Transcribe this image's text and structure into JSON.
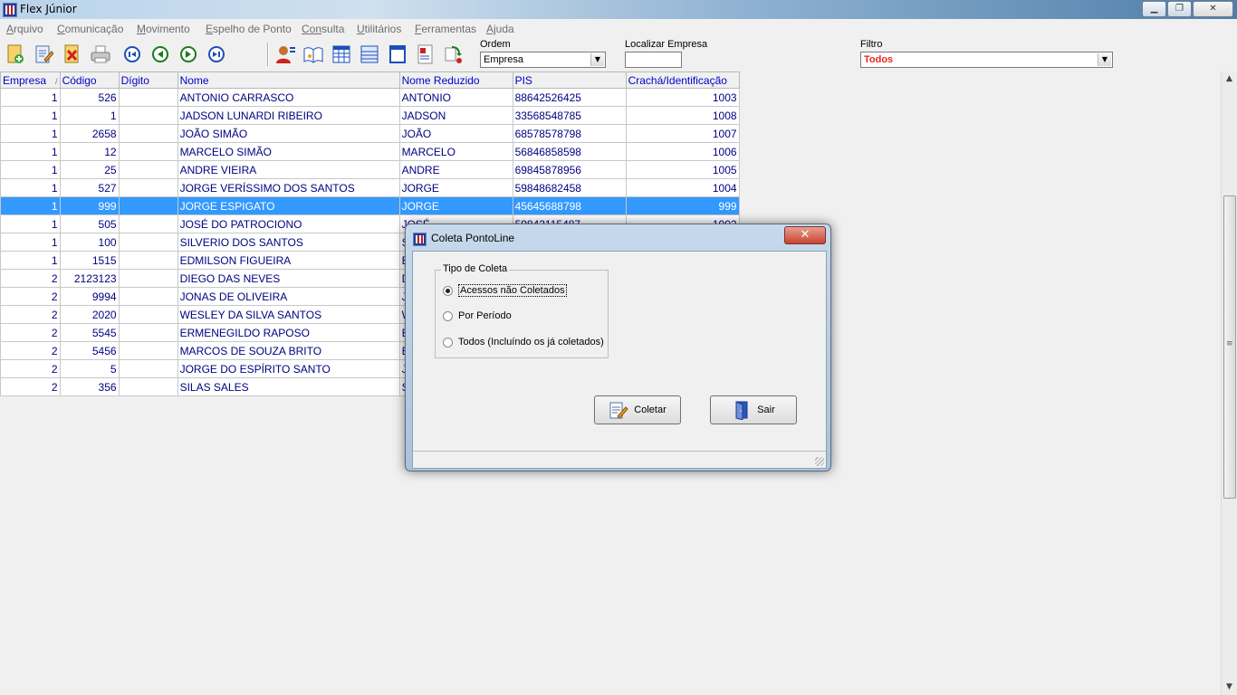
{
  "window": {
    "title": "Flex Júnior"
  },
  "menu": [
    {
      "label": "Arquivo",
      "hot": "A",
      "rest": "rquivo"
    },
    {
      "label": "Comunicação",
      "hot": "C",
      "rest": "omunicação"
    },
    {
      "label": "Movimento",
      "hot": "M",
      "rest": "ovimento"
    },
    {
      "label": "Espelho de Ponto",
      "hot": "E",
      "rest": "spelho de Ponto"
    },
    {
      "label": "Consulta",
      "hot": "Con",
      "rest": "sulta"
    },
    {
      "label": "Utilitários",
      "hot": "U",
      "rest": "tilitários"
    },
    {
      "label": "Ferramentas",
      "hot": "F",
      "rest": "erramentas"
    },
    {
      "label": "Ajuda",
      "hot": "Aj",
      "rest": "uda"
    }
  ],
  "toolbar": {
    "ordem_label": "Ordem",
    "ordem_value": "Empresa",
    "localizar_label": "Localizar Empresa",
    "localizar_value": "",
    "filtro_label": "Filtro",
    "filtro_value": "Todos",
    "filtro_color": "#e8281b"
  },
  "grid": {
    "columns": [
      "Empresa",
      "Código",
      "Dígito",
      "Nome",
      "Nome Reduzido",
      "PIS",
      "Crachá/Identificação"
    ],
    "sort_glyph": "/",
    "selected_index": 6,
    "rows": [
      {
        "empresa": "1",
        "codigo": "526",
        "digito": "",
        "nome": "ANTONIO CARRASCO",
        "reduzido": "ANTONIO",
        "pis": "88642526425",
        "cracha": "1003"
      },
      {
        "empresa": "1",
        "codigo": "1",
        "digito": "",
        "nome": "JADSON LUNARDI RIBEIRO",
        "reduzido": "JADSON",
        "pis": "33568548785",
        "cracha": "1008"
      },
      {
        "empresa": "1",
        "codigo": "2658",
        "digito": "",
        "nome": "JOÃO SIMÃO",
        "reduzido": "JOÃO",
        "pis": "68578578798",
        "cracha": "1007"
      },
      {
        "empresa": "1",
        "codigo": "12",
        "digito": "",
        "nome": "MARCELO SIMÃO",
        "reduzido": "MARCELO",
        "pis": "56846858598",
        "cracha": "1006"
      },
      {
        "empresa": "1",
        "codigo": "25",
        "digito": "",
        "nome": "ANDRE VIEIRA",
        "reduzido": "ANDRE",
        "pis": "69845878956",
        "cracha": "1005"
      },
      {
        "empresa": "1",
        "codigo": "527",
        "digito": "",
        "nome": "JORGE VERÍSSIMO DOS SANTOS",
        "reduzido": "JORGE",
        "pis": "59848682458",
        "cracha": "1004"
      },
      {
        "empresa": "1",
        "codigo": "999",
        "digito": "",
        "nome": "JORGE ESPIGATO",
        "reduzido": "JORGE",
        "pis": "45645688798",
        "cracha": "999"
      },
      {
        "empresa": "1",
        "codigo": "505",
        "digito": "",
        "nome": "JOSÉ DO PATROCIONO",
        "reduzido": "JOSÉ",
        "pis": "59842115487",
        "cracha": "1002"
      },
      {
        "empresa": "1",
        "codigo": "100",
        "digito": "",
        "nome": "SILVERIO DOS SANTOS",
        "reduzido": "S",
        "pis": "",
        "cracha": ""
      },
      {
        "empresa": "1",
        "codigo": "1515",
        "digito": "",
        "nome": "EDMILSON FIGUEIRA",
        "reduzido": "E",
        "pis": "",
        "cracha": ""
      },
      {
        "empresa": "2",
        "codigo": "2123123",
        "digito": "",
        "nome": "DIEGO DAS NEVES",
        "reduzido": "D",
        "pis": "",
        "cracha": ""
      },
      {
        "empresa": "2",
        "codigo": "9994",
        "digito": "",
        "nome": "JONAS DE OLIVEIRA",
        "reduzido": "J",
        "pis": "",
        "cracha": ""
      },
      {
        "empresa": "2",
        "codigo": "2020",
        "digito": "",
        "nome": "WESLEY DA SILVA SANTOS",
        "reduzido": "W",
        "pis": "",
        "cracha": ""
      },
      {
        "empresa": "2",
        "codigo": "5545",
        "digito": "",
        "nome": "ERMENEGILDO RAPOSO",
        "reduzido": "E",
        "pis": "",
        "cracha": ""
      },
      {
        "empresa": "2",
        "codigo": "5456",
        "digito": "",
        "nome": "MARCOS DE SOUZA BRITO",
        "reduzido": "E",
        "pis": "",
        "cracha": ""
      },
      {
        "empresa": "2",
        "codigo": "5",
        "digito": "",
        "nome": "JORGE DO ESPÍRITO SANTO",
        "reduzido": "J",
        "pis": "",
        "cracha": ""
      },
      {
        "empresa": "2",
        "codigo": "356",
        "digito": "",
        "nome": "SILAS SALES",
        "reduzido": "S",
        "pis": "",
        "cracha": ""
      }
    ]
  },
  "dialog": {
    "title": "Coleta PontoLine",
    "close_glyph": "✕",
    "group_title": "Tipo de Coleta",
    "options": [
      "Acessos não Coletados",
      "Por Período",
      "Todos (Incluíndo os já coletados)"
    ],
    "selected_option": 0,
    "coletar_label": "Coletar",
    "sair_label": "Sair"
  }
}
